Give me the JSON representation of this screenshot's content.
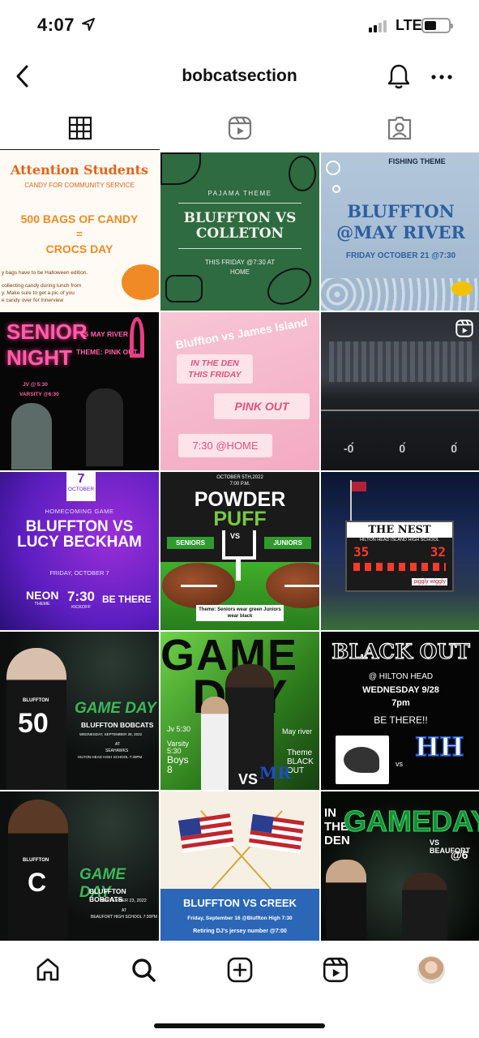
{
  "status_bar": {
    "time": "4:07",
    "network": "LTE"
  },
  "header": {
    "username": "bobcatsection"
  },
  "tabs": [
    {
      "name": "grid",
      "icon": "grid-icon"
    },
    {
      "name": "reels",
      "icon": "reels-icon"
    },
    {
      "name": "tagged",
      "icon": "tagged-icon"
    }
  ],
  "posts": [
    {
      "title": "Attention Students",
      "subtitle": "CANDY FOR COMMUNITY SERVICE",
      "line1": "500 BAGS OF CANDY",
      "eq": "=",
      "line2": "CROCS DAY",
      "fine1": "y bags have to be Halloween edition.",
      "fine2": "collecting candy during lunch from",
      "fine3": "y. Make sure to get a pic of you",
      "fine4": "e candy over for Innerview"
    },
    {
      "kicker": "PAJAMA THEME",
      "title": "BLUFFTON VS COLLETON",
      "detail": "THIS FRIDAY @7:30 AT HOME"
    },
    {
      "kicker": "FISHING THEME",
      "title": "BLUFFTON @MAY RIVER",
      "detail": "FRIDAY OCTOBER 21 @7:30"
    },
    {
      "title": "SENIOR NIGHT",
      "right1": "VS MAY RIVER",
      "right2": "THEME: PINK OUT",
      "jv": "JV @ 5:30",
      "varsity": "VARSITY @6:30"
    },
    {
      "title": "Bluffton vs James Island",
      "b1": "IN THE DEN THIS FRIDAY",
      "b2": "PINK OUT",
      "b3": "7:30 @HOME"
    },
    {
      "yard1": "-0́́",
      "yard2": "0́",
      "yard3": "0́"
    },
    {
      "date_num": "7",
      "date_month": "OCTOBER",
      "kicker": "HOMECOMING GAME",
      "title": "BLUFFTON VS LUCY BECKHAM",
      "day": "FRIDAY, OCTOBER 7",
      "neon": "NEON",
      "neon_sub": "THEME",
      "time": "7:30",
      "time_sub": "KICKOFF",
      "be_there": "BE THERE"
    },
    {
      "date": "OCTOBER 5TH,2022",
      "time": "7:00 P.M.",
      "t1": "POWDER",
      "t2": "PUFF",
      "left": "SENIORS",
      "vs": "VS",
      "right": "JUNIORS",
      "theme": "Theme: Seniors wear green Juniors wear black"
    },
    {
      "sign": "THE NEST",
      "school": "HILTON HEAD ISLAND HIGH SCHOOL",
      "home": "35",
      "away": "32",
      "brand": "piggly wiggly"
    },
    {
      "number": "50",
      "jersey": "BLUFFTON",
      "game_day": "GAME DAY",
      "team": "BLUFFTON BOBCATS",
      "date": "WEDNESDAY, SEPTEMBER 28, 2022",
      "at": "AT",
      "opponent": "SEAHAWKS",
      "venue": "HILTON HEAD HIGH SCHOOL 7:30PM"
    },
    {
      "t1": "GAME",
      "t2": "DAY",
      "jv": "Jv 5:30",
      "varsity": "Varsity 5:30",
      "boys": "Boys 8",
      "vs": "VS",
      "may": "May river",
      "theme": "Theme BLACK OUT",
      "mr": "MR"
    },
    {
      "title": "BLACK OUT",
      "where": "@ HILTON HEAD",
      "when": "WEDNESDAY 9/28",
      "time": "7pm",
      "be_there": "BE THERE!!",
      "vs": "vs",
      "hh": "HH"
    },
    {
      "number": "C",
      "jersey": "BLUFFTON",
      "game_day": "GAME DAY",
      "team": "BLUFFTON BOBCATS",
      "date": "SEPTEMBER 23, 2022",
      "at": "AT",
      "venue": "BEAUFORT HIGH SCHOOL 7:30PM"
    },
    {
      "title": "BLUFFTON VS CREEK",
      "line1": "Friday, September 16 @Bluffton High 7:30",
      "line2": "Retiring DJ's jersey number @7:00"
    },
    {
      "in_the_den": "IN THE DEN",
      "title": "GAMEDAY",
      "vs": "VS BEAUFORT",
      "time": "@6"
    }
  ],
  "bottom_nav": [
    {
      "name": "home",
      "icon": "home-icon"
    },
    {
      "name": "search",
      "icon": "search-icon"
    },
    {
      "name": "create",
      "icon": "create-icon"
    },
    {
      "name": "reels",
      "icon": "reels-icon"
    },
    {
      "name": "profile",
      "icon": "avatar"
    }
  ]
}
